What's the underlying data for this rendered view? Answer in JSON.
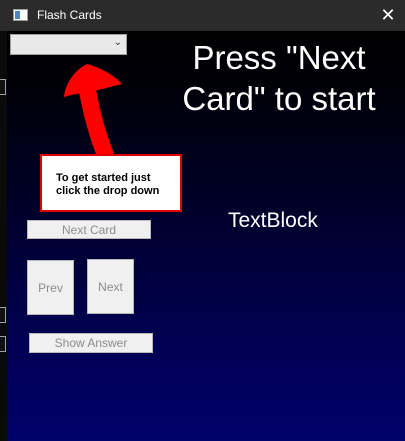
{
  "window": {
    "title": "Flash Cards",
    "close_glyph": "✕"
  },
  "dropdown": {
    "selected_value": "",
    "chevron_glyph": "⌄"
  },
  "main": {
    "prompt": "Press \"Next\nCard\" to start",
    "callout": "To get started just\nclick the drop down",
    "textblock": "TextBlock"
  },
  "buttons": {
    "next_card": "Next Card",
    "prev": "Prev",
    "next": "Next",
    "show_answer": "Show Answer"
  },
  "colors": {
    "arrow": "#ff0000",
    "callout_border": "#e00000",
    "background_top": "#000000",
    "background_bottom": "#00006b"
  }
}
